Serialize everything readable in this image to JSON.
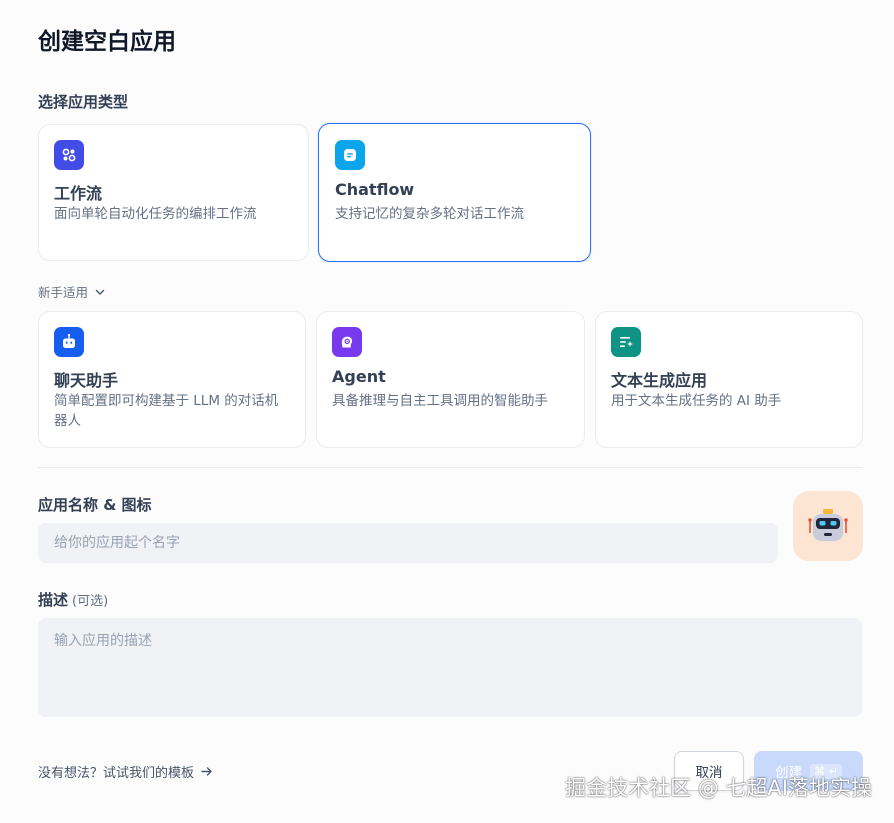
{
  "dialog": {
    "title": "创建空白应用",
    "type_section_label": "选择应用类型",
    "advanced_types": [
      {
        "title": "工作流",
        "desc": "面向单轮自动化任务的编排工作流",
        "color": "#444ce7",
        "icon": "workflow-icon",
        "selected": false
      },
      {
        "title": "Chatflow",
        "desc": "支持记忆的复杂多轮对话工作流",
        "color": "#0ba5ec",
        "icon": "chatflow-icon",
        "selected": true
      }
    ],
    "beginner_toggle": "新手适用",
    "beginner_types": [
      {
        "title": "聊天助手",
        "desc": "简单配置即可构建基于 LLM 的对话机器人",
        "color": "#155eef",
        "icon": "chatbot-icon"
      },
      {
        "title": "Agent",
        "desc": "具备推理与自主工具调用的智能助手",
        "color": "#7839ee",
        "icon": "agent-icon"
      },
      {
        "title": "文本生成应用",
        "desc": "用于文本生成任务的 AI 助手",
        "color": "#0e9384",
        "icon": "text-generation-icon"
      }
    ],
    "name_section_label": "应用名称 & 图标",
    "name_placeholder": "给你的应用起个名字",
    "app_icon": {
      "name": "robot-icon",
      "background": "#fde5d4"
    },
    "desc_label": "描述",
    "desc_optional": "(可选)",
    "desc_placeholder": "输入应用的描述",
    "template_link": "没有想法？试试我们的模板",
    "cancel_label": "取消",
    "create_label": "创建",
    "create_shortcut": "⌘ ↵"
  },
  "watermark": "掘金技术社区 @ 七超AI落地实操"
}
